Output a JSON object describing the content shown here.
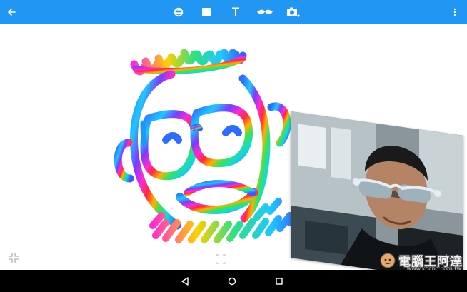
{
  "toolbar": {
    "color": "#2196f3",
    "back_icon": "arrow-back-icon",
    "tools": [
      "emoji-face-icon",
      "square-shape-icon",
      "text-tool-icon",
      "mustache-icon",
      "camera-add-icon"
    ],
    "overflow_icon": "more-vert-icon"
  },
  "canvas": {
    "drawing": "rainbow-face-doodle",
    "photo": "selfie-with-sunglasses",
    "corner_icons": [
      "shrink-corners-icon",
      "frame-corner-icon",
      "expand-corner-icon"
    ]
  },
  "navbar": {
    "buttons": [
      "back-triangle-icon",
      "home-circle-icon",
      "recents-square-icon"
    ]
  },
  "watermark": {
    "text": "電腦王阿達",
    "url": "www.kocpc.com.tw"
  }
}
